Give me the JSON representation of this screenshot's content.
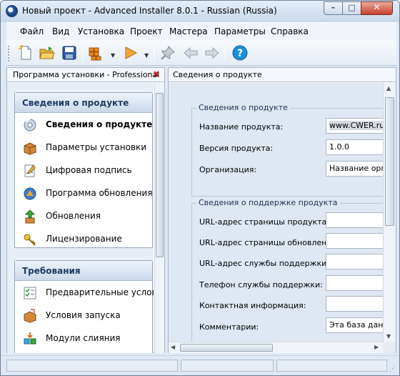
{
  "window": {
    "title": "Новый проект - Advanced Installer 8.0.1 - Russian (Russia)",
    "minimize_glyph": "–",
    "maximize_glyph": "□",
    "close_glyph": "✕"
  },
  "menu": [
    "Файл",
    "Вид",
    "Установка",
    "Проект",
    "Мастера",
    "Параметры",
    "Справка"
  ],
  "toolbar": {
    "icons": [
      "new-file-icon",
      "open-folder-icon",
      "save-icon",
      "build-icon",
      "run-icon",
      "pin-icon",
      "back-arrow-icon",
      "forward-arrow-icon",
      "help-icon"
    ]
  },
  "left_panel": {
    "header": "Программа установки - Professional",
    "close_glyph": "x",
    "groups": [
      {
        "title": "Сведения о продукте",
        "items": [
          {
            "label": "Сведения о продукте",
            "icon": "cd-icon",
            "active": true
          },
          {
            "label": "Параметры установки",
            "icon": "box-icon",
            "active": false
          },
          {
            "label": "Цифровая подпись",
            "icon": "signature-icon",
            "active": false
          },
          {
            "label": "Программа обновления",
            "icon": "updater-icon",
            "active": false
          },
          {
            "label": "Обновления",
            "icon": "updates-icon",
            "active": false
          },
          {
            "label": "Лицензирование",
            "icon": "key-icon",
            "active": false
          }
        ]
      },
      {
        "title": "Требования",
        "items": [
          {
            "label": "Предварительные условия",
            "icon": "checklist-icon",
            "active": false
          },
          {
            "label": "Условия запуска",
            "icon": "launch-box-icon",
            "active": false
          },
          {
            "label": "Модули слияния",
            "icon": "merge-modules-icon",
            "active": false
          }
        ]
      }
    ]
  },
  "right_panel": {
    "header": "Сведения о продукте",
    "product_section": {
      "title": "Сведения о продукте",
      "fields": [
        {
          "label": "Название продукта:",
          "value": "www.CWER.ru"
        },
        {
          "label": "Версия продукта:",
          "value": "1.0.0"
        },
        {
          "label": "Организация:",
          "value": "Название орга"
        }
      ]
    },
    "support_section": {
      "title": "Сведения о поддержке продукта",
      "fields": [
        {
          "label": "URL-адрес страницы продукта:",
          "value": ""
        },
        {
          "label": "URL-адрес страницы обновлений:",
          "value": ""
        },
        {
          "label": "URL-адрес службы поддержки:",
          "value": ""
        },
        {
          "label": "Телефон службы поддержки:",
          "value": ""
        },
        {
          "label": "Контактная информация:",
          "value": ""
        },
        {
          "label": "Комментарии:",
          "value": "Эта база данн"
        }
      ]
    }
  },
  "colors": {
    "accent": "#1e3c64",
    "close_button": "#c7402c",
    "help_icon": "#1a8fd8"
  }
}
